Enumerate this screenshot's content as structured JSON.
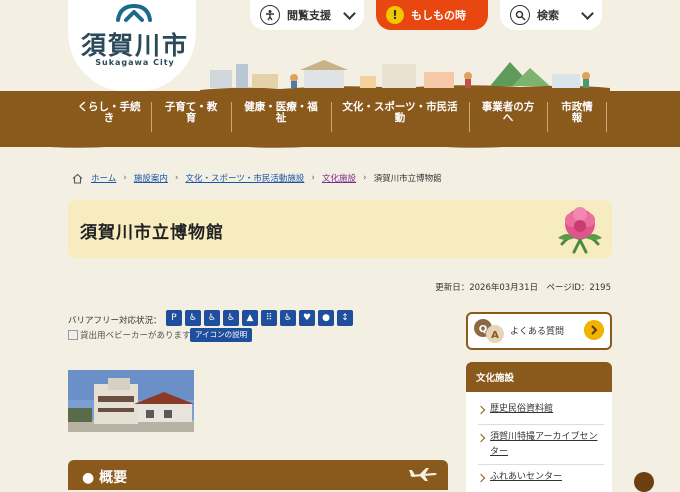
{
  "header": {
    "logo_text": "須賀川市",
    "logo_sub": "Sukagawa City",
    "buttons": {
      "accessibility": "閲覧支援",
      "emergency": "もしもの時",
      "search": "検索"
    }
  },
  "nav": [
    {
      "line1": "くらし・手続",
      "line2": "き"
    },
    {
      "line1": "子育て・教",
      "line2": "育"
    },
    {
      "line1": "健康・医療・福",
      "line2": "祉"
    },
    {
      "line1": "文化・スポーツ・市民活",
      "line2": "動"
    },
    {
      "line1": "事業者の方",
      "line2": "へ"
    },
    {
      "line1": "市政情",
      "line2": "報"
    }
  ],
  "breadcrumb": {
    "home": "ホーム",
    "items": [
      "施設案内",
      "文化・スポーツ・市民活動施設",
      "文化施設"
    ],
    "current": "須賀川市立博物館",
    "separator": "›"
  },
  "page": {
    "title": "須賀川市立博物館",
    "updated": "更新日：2026年03月31日　ページID：2195"
  },
  "barrier_free": {
    "label": "バリアフリー対応状況：",
    "icons": [
      "accessible-parking-icon",
      "wheelchair-icon",
      "accessible-toilet-icon",
      "wheelchair-access-icon",
      "assistance-icon",
      "braille-block-icon",
      "accessible-entrance-icon",
      "nursing-room-icon",
      "baby-icon",
      "elevator-icon"
    ],
    "stroller_alt": "貸出用ベビーカーがあります",
    "icon_desc": "アイコンの説明"
  },
  "photo_alt": "",
  "section": {
    "title": "概要"
  },
  "sidebar": {
    "faq": "よくある質問",
    "category": "文化施設",
    "links": [
      "歴史民俗資料館",
      "須賀川特撮アーカイブセンター",
      "ふれあいセンター"
    ]
  },
  "colors": {
    "nav_brown": "#8a5a1c",
    "emergency_orange": "#e8470f",
    "title_bg": "#f7ecc0",
    "link_blue": "#1a56a8",
    "bf_icon_blue": "#1f4e9c"
  }
}
